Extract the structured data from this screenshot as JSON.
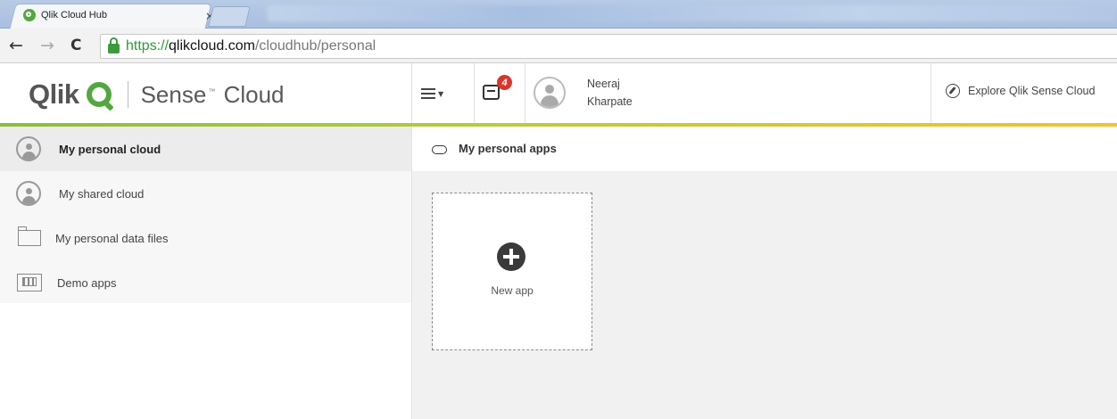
{
  "browser": {
    "tab_title": "Qlik Cloud Hub",
    "tab_close": "×",
    "url_scheme": "https://",
    "url_host": "qlikcloud.com",
    "url_path": "/cloudhub/personal",
    "back_glyph": "←",
    "forward_glyph": "→",
    "reload_glyph": "C"
  },
  "header": {
    "logo_brand": "Qlik",
    "logo_product": "Sense",
    "logo_tm": "™",
    "logo_suffix": "Cloud",
    "notification_count": "4",
    "user_first": "Neeraj",
    "user_last": "Kharpate",
    "explore_label": "Explore Qlik Sense Cloud",
    "accent_colors": [
      "#52a83e",
      "#f2c22c"
    ]
  },
  "sidebar": {
    "items": [
      {
        "label": "My personal cloud",
        "icon": "person-icon",
        "active": true
      },
      {
        "label": "My shared cloud",
        "icon": "person-icon",
        "active": false
      },
      {
        "label": "My personal data files",
        "icon": "folder-icon",
        "active": false
      },
      {
        "label": "Demo apps",
        "icon": "demo-apps-icon",
        "active": false
      }
    ]
  },
  "main": {
    "title": "My personal apps",
    "new_app_label": "New app"
  }
}
